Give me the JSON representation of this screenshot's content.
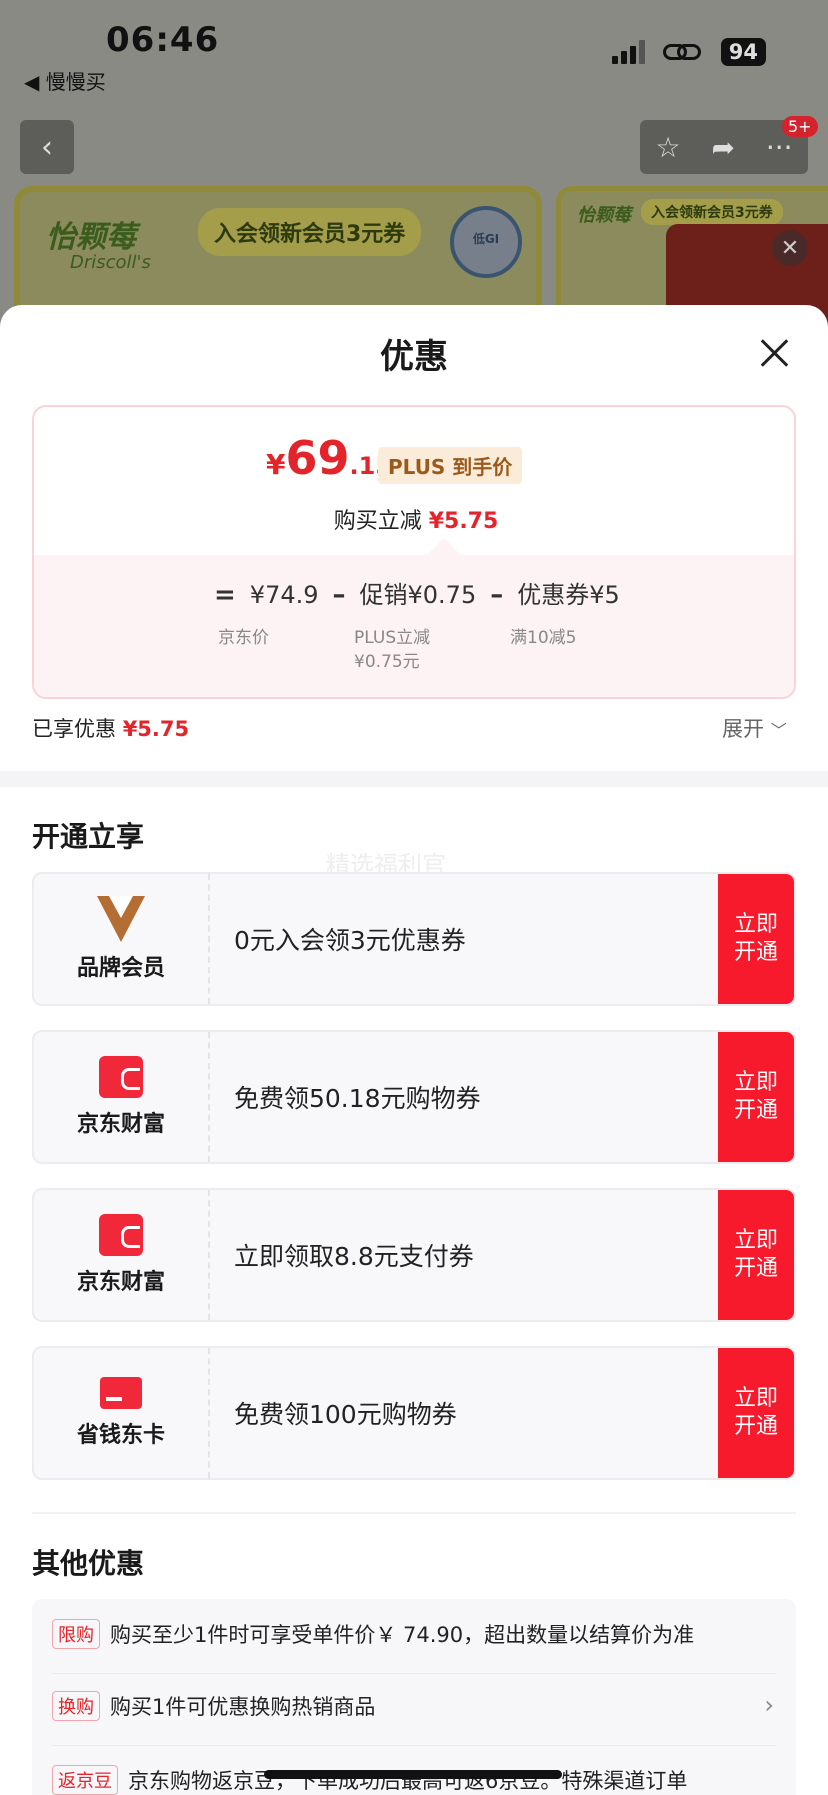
{
  "status_bar": {
    "time": "06:46",
    "back_app": "◀ 慢慢买",
    "battery": "94"
  },
  "background_page": {
    "nav_badge": "5+",
    "banner_brand": "怡颗莓",
    "banner_brand_en": "Driscoll's",
    "banner_pill": "入会领新会员3元券",
    "banner_seal": "低GI",
    "banner2_brand": "怡颗莓",
    "banner2_pill": "入会领新会员3元券"
  },
  "sheet": {
    "title": "优惠",
    "price_card": {
      "currency": "¥",
      "price_int": "69",
      "price_dec": ".15",
      "plus_tag": "PLUS 到手价",
      "reduce_label": "购买立减",
      "reduce_value": "¥5.75",
      "formula": {
        "equals": "=",
        "jd_price": "¥74.9",
        "jd_price_label": "京东价",
        "minus1": "–",
        "promo": "促销¥0.75",
        "promo_label_1": "PLUS立减",
        "promo_label_2": "¥0.75元",
        "minus2": "–",
        "coupon": "优惠券¥5",
        "coupon_label": "满10减5"
      }
    },
    "saved_label": "已享优惠",
    "saved_value": "¥5.75",
    "expand_label": "展开",
    "open_section_title": "开通立享",
    "watermark": "精选福利官",
    "benefits": [
      {
        "label": "品牌会员",
        "desc": "0元入会领3元优惠券",
        "button": "立即开通",
        "icon": "brand-member-v-icon"
      },
      {
        "label": "京东财富",
        "desc": "免费领50.18元购物券",
        "button": "立即开通",
        "icon": "wallet-icon"
      },
      {
        "label": "京东财富",
        "desc": "立即领取8.8元支付券",
        "button": "立即开通",
        "icon": "wallet-icon"
      },
      {
        "label": "省钱东卡",
        "desc": "免费领100元购物券",
        "button": "立即开通",
        "icon": "card-icon"
      }
    ],
    "other_section_title": "其他优惠",
    "other_offers": [
      {
        "tag": "限购",
        "text": "购买至少1件时可享受单件价￥ 74.90，超出数量以结算价为准"
      },
      {
        "tag": "换购",
        "text": "购买1件可优惠换购热销商品"
      },
      {
        "tag": "返京豆",
        "text": "京东购物返京豆，下单成功后最高可返6京豆。特殊渠道订单"
      }
    ]
  }
}
